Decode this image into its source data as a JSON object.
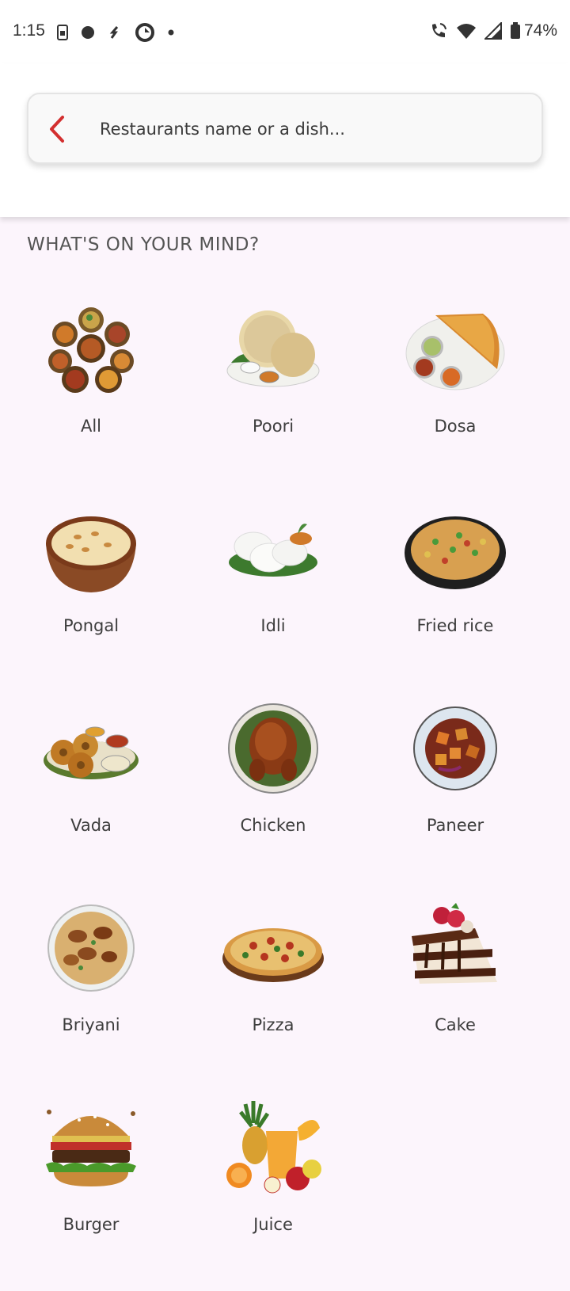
{
  "status_bar": {
    "time": "1:15",
    "battery": "74%",
    "icons": [
      "sim-icon",
      "dot-icon",
      "signal-f-icon",
      "sync-icon",
      "small-dot-icon",
      "wifi-call-icon",
      "wifi-icon",
      "cell-signal-icon",
      "battery-icon"
    ]
  },
  "search": {
    "placeholder": "Restaurants name or a dish...",
    "back_icon": "chevron-left-icon",
    "accent_color": "#d32f2f"
  },
  "section": {
    "title": "WHAT'S ON YOUR MIND?"
  },
  "categories": [
    {
      "label": "All",
      "icon": "thali-assortment-icon"
    },
    {
      "label": "Poori",
      "icon": "poori-icon"
    },
    {
      "label": "Dosa",
      "icon": "dosa-icon"
    },
    {
      "label": "Pongal",
      "icon": "pongal-icon"
    },
    {
      "label": "Idli",
      "icon": "idli-icon"
    },
    {
      "label": "Fried rice",
      "icon": "fried-rice-icon"
    },
    {
      "label": "Vada",
      "icon": "vada-icon"
    },
    {
      "label": "Chicken",
      "icon": "chicken-icon"
    },
    {
      "label": "Paneer",
      "icon": "paneer-icon"
    },
    {
      "label": "Briyani",
      "icon": "briyani-icon"
    },
    {
      "label": "Pizza",
      "icon": "pizza-icon"
    },
    {
      "label": "Cake",
      "icon": "cake-icon"
    },
    {
      "label": "Burger",
      "icon": "burger-icon"
    },
    {
      "label": "Juice",
      "icon": "juice-icon"
    }
  ]
}
